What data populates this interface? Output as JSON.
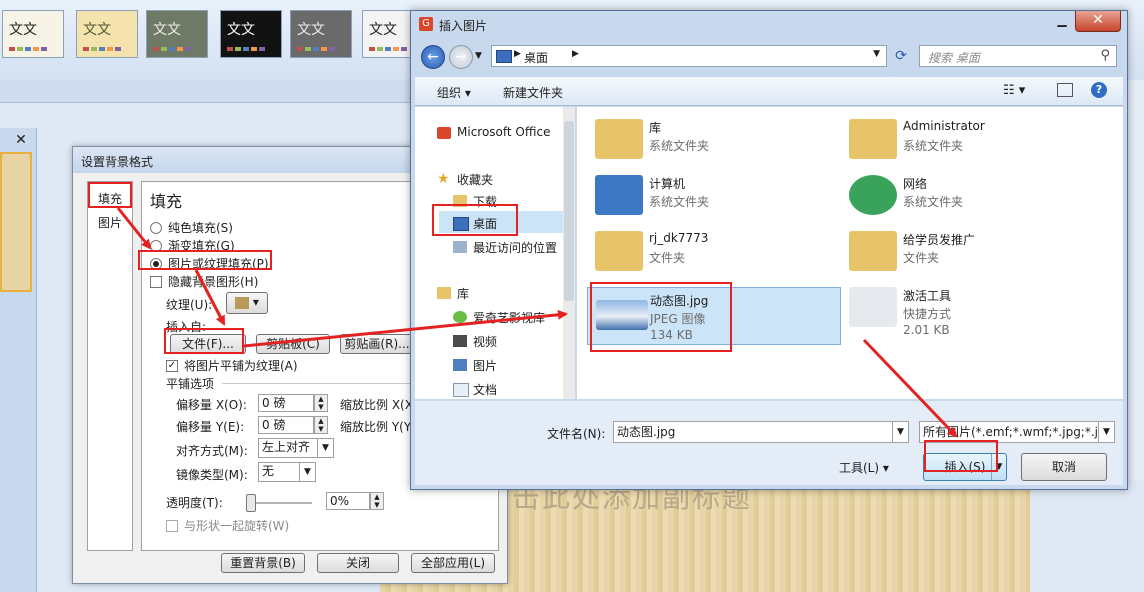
{
  "ribbon": {
    "themes": [
      {
        "label": "文文",
        "bg": "#f7f3e6",
        "fg": "#222"
      },
      {
        "label": "文文",
        "bg": "#f5e3ad",
        "fg": "#553"
      },
      {
        "label": "文文",
        "bg": "#6f7a66",
        "fg": "#eee"
      },
      {
        "label": "文文",
        "bg": "#121212",
        "fg": "#fff"
      },
      {
        "label": "文文",
        "bg": "#6a6a6a",
        "fg": "#eee"
      },
      {
        "label": "文文",
        "bg": "#f4f4f4",
        "fg": "#222"
      }
    ]
  },
  "slide": {
    "subtitle": "击此处添加副标题"
  },
  "format_dialog": {
    "title": "设置背景格式",
    "nav": {
      "fill": "填充",
      "picture": "图片"
    },
    "section_title": "填充",
    "options": {
      "solid": "纯色填充(S)",
      "gradient": "渐变填充(G)",
      "picture_texture": "图片或纹理填充(P)",
      "hide_bg": "隐藏背景图形(H)"
    },
    "texture_label": "纹理(U):",
    "insert_from": "插入自:",
    "buttons": {
      "file": "文件(F)...",
      "clipboard": "剪贴板(C)",
      "clipart": "剪贴画(R)..."
    },
    "tile_checkbox": "将图片平铺为纹理(A)",
    "tile_options": "平铺选项",
    "offset_x_label": "偏移量 X(O):",
    "offset_x_value": "0 磅",
    "offset_y_label": "偏移量 Y(E):",
    "offset_y_value": "0 磅",
    "scale_x_label": "缩放比例 X(X",
    "scale_y_label": "缩放比例 Y(Y",
    "align_label": "对齐方式(M):",
    "align_value": "左上对齐",
    "mirror_label": "镜像类型(M):",
    "mirror_value": "无",
    "transparency_label": "透明度(T):",
    "transparency_value": "0%",
    "rotate_checkbox": "与形状一起旋转(W)",
    "footer": {
      "reset": "重置背景(B)",
      "close": "关闭",
      "apply_all": "全部应用(L)"
    }
  },
  "insert_dialog": {
    "title": "插入图片",
    "address": "桌面",
    "search_placeholder": "搜索 桌面",
    "toolbar": {
      "organize": "组织",
      "new_folder": "新建文件夹"
    },
    "tree": {
      "ms_office": "Microsoft Office",
      "favorites": "收藏夹",
      "downloads": "下载",
      "desktop": "桌面",
      "recent": "最近访问的位置",
      "libraries": "库",
      "iqiyi": "爱奇艺影视库",
      "videos": "视频",
      "pictures": "图片",
      "documents": "文档"
    },
    "files": [
      {
        "name": "库",
        "sub": "系统文件夹"
      },
      {
        "name": "Administrator",
        "sub": "系统文件夹"
      },
      {
        "name": "计算机",
        "sub": "系统文件夹"
      },
      {
        "name": "网络",
        "sub": "系统文件夹"
      },
      {
        "name": "rj_dk7773",
        "sub": "文件夹"
      },
      {
        "name": "给学员发推广",
        "sub": "文件夹"
      },
      {
        "name": "动态图.jpg",
        "sub": "JPEG 图像",
        "size": "134 KB"
      },
      {
        "name": "激活工具",
        "sub": "快捷方式",
        "size": "2.01 KB"
      }
    ],
    "filename_label": "文件名(N):",
    "filename_value": "动态图.jpg",
    "filter_value": "所有图片(*.emf;*.wmf;*.jpg;*.j",
    "tools_label": "工具(L)",
    "insert_button": "插入(S)",
    "cancel_button": "取消"
  },
  "colors": {
    "annotation": "#e52222",
    "selection": "#cce4f7"
  }
}
